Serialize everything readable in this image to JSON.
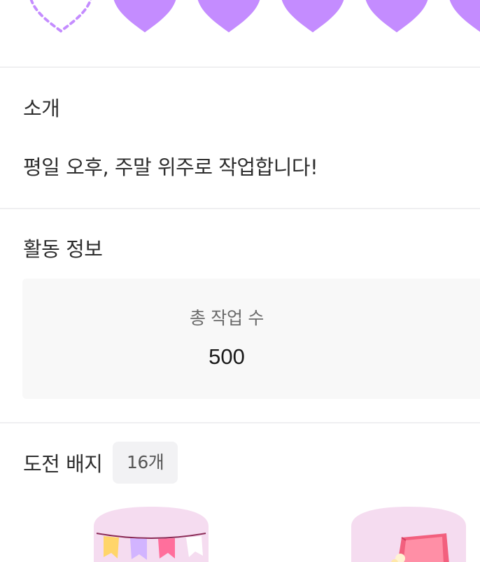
{
  "rating": {
    "hearts": [
      {
        "state": "empty",
        "icon": "heart-outline-icon"
      },
      {
        "state": "filled",
        "icon": "heart-icon"
      },
      {
        "state": "filled",
        "icon": "heart-icon"
      },
      {
        "state": "filled",
        "icon": "heart-icon"
      },
      {
        "state": "filled",
        "icon": "heart-icon"
      },
      {
        "state": "filled",
        "icon": "heart-icon"
      }
    ],
    "color": "#c48cff"
  },
  "intro": {
    "title": "소개",
    "text": "평일 오후, 주말 위주로 작업합니다!"
  },
  "activity": {
    "title": "활동 정보",
    "total_tasks_label": "총 작업 수",
    "total_tasks_value": "500"
  },
  "badges": {
    "title": "도전 배지",
    "count": "16개",
    "items": [
      {
        "icon": "party-flags-badge-icon"
      },
      {
        "icon": "book-badge-icon"
      }
    ]
  },
  "colors": {
    "accent": "#c48cff",
    "divider": "#efeff1",
    "card_bg": "#f8f8f8",
    "badge_bg": "#f5dcf0"
  }
}
